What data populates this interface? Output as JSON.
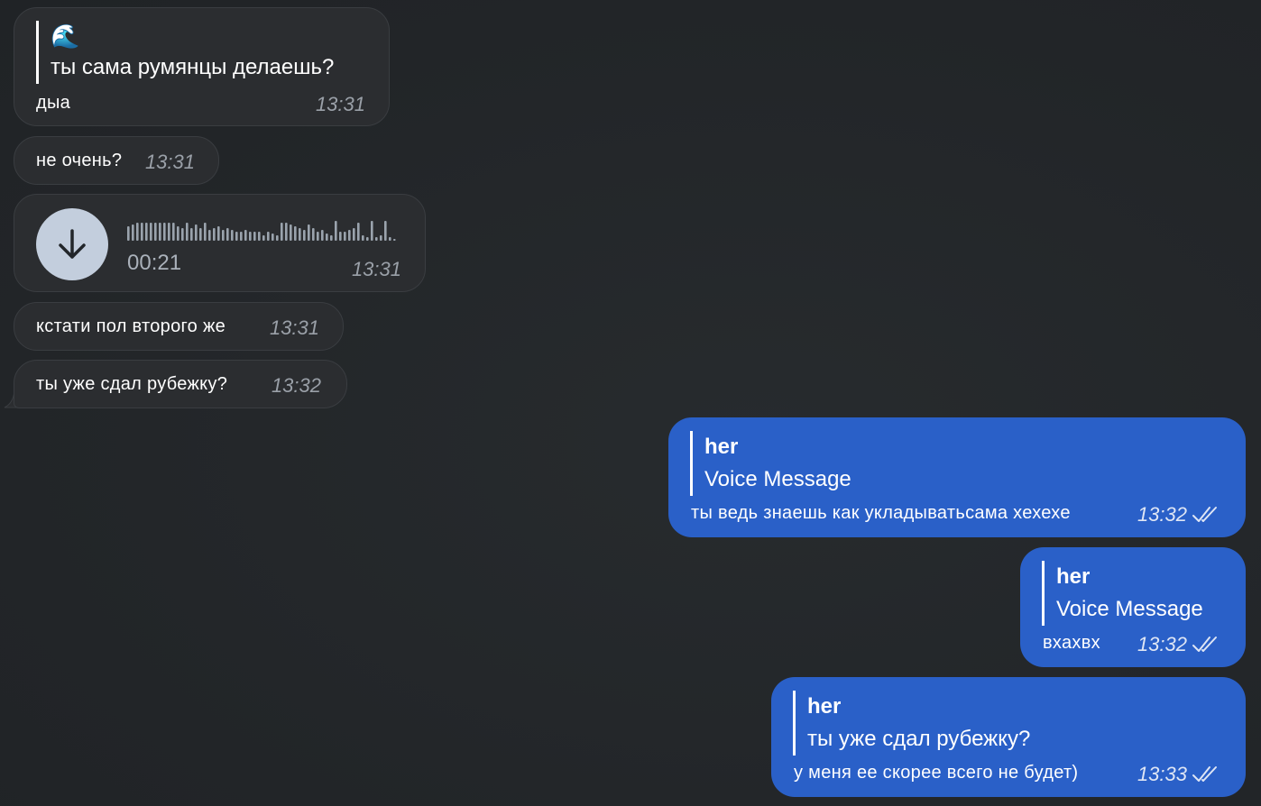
{
  "messages": {
    "m1": {
      "reply_emoji": "🌊",
      "reply_text": "ты сама румянцы делаешь?",
      "text": "дыа",
      "time": "13:31"
    },
    "m2": {
      "text": "не очень?",
      "time": "13:31"
    },
    "m3": {
      "duration": "00:21",
      "time": "13:31",
      "icon": "download-arrow-icon"
    },
    "m4": {
      "text": "кстати пол второго же",
      "time": "13:31"
    },
    "m5": {
      "text": "ты уже сдал рубежку?",
      "time": "13:32"
    },
    "m6": {
      "reply_name": "her",
      "reply_text": "Voice Message",
      "text": "ты ведь знаешь как укладыватьсама хехехе",
      "time": "13:32",
      "status_icon": "double-check-icon"
    },
    "m7": {
      "reply_name": "her",
      "reply_text": "Voice Message",
      "text": "вхахвх",
      "time": "13:32",
      "status_icon": "double-check-icon"
    },
    "m8": {
      "reply_name": "her",
      "reply_text": "ты уже сдал рубежку?",
      "text": "у меня ее скорее всего не будет)",
      "time": "13:33",
      "status_icon": "double-check-icon"
    }
  },
  "colors": {
    "background": "#232629",
    "incoming_bubble": "#2b2d30",
    "outgoing_bubble": "#2a60c8",
    "download_button": "#c3cedd"
  }
}
